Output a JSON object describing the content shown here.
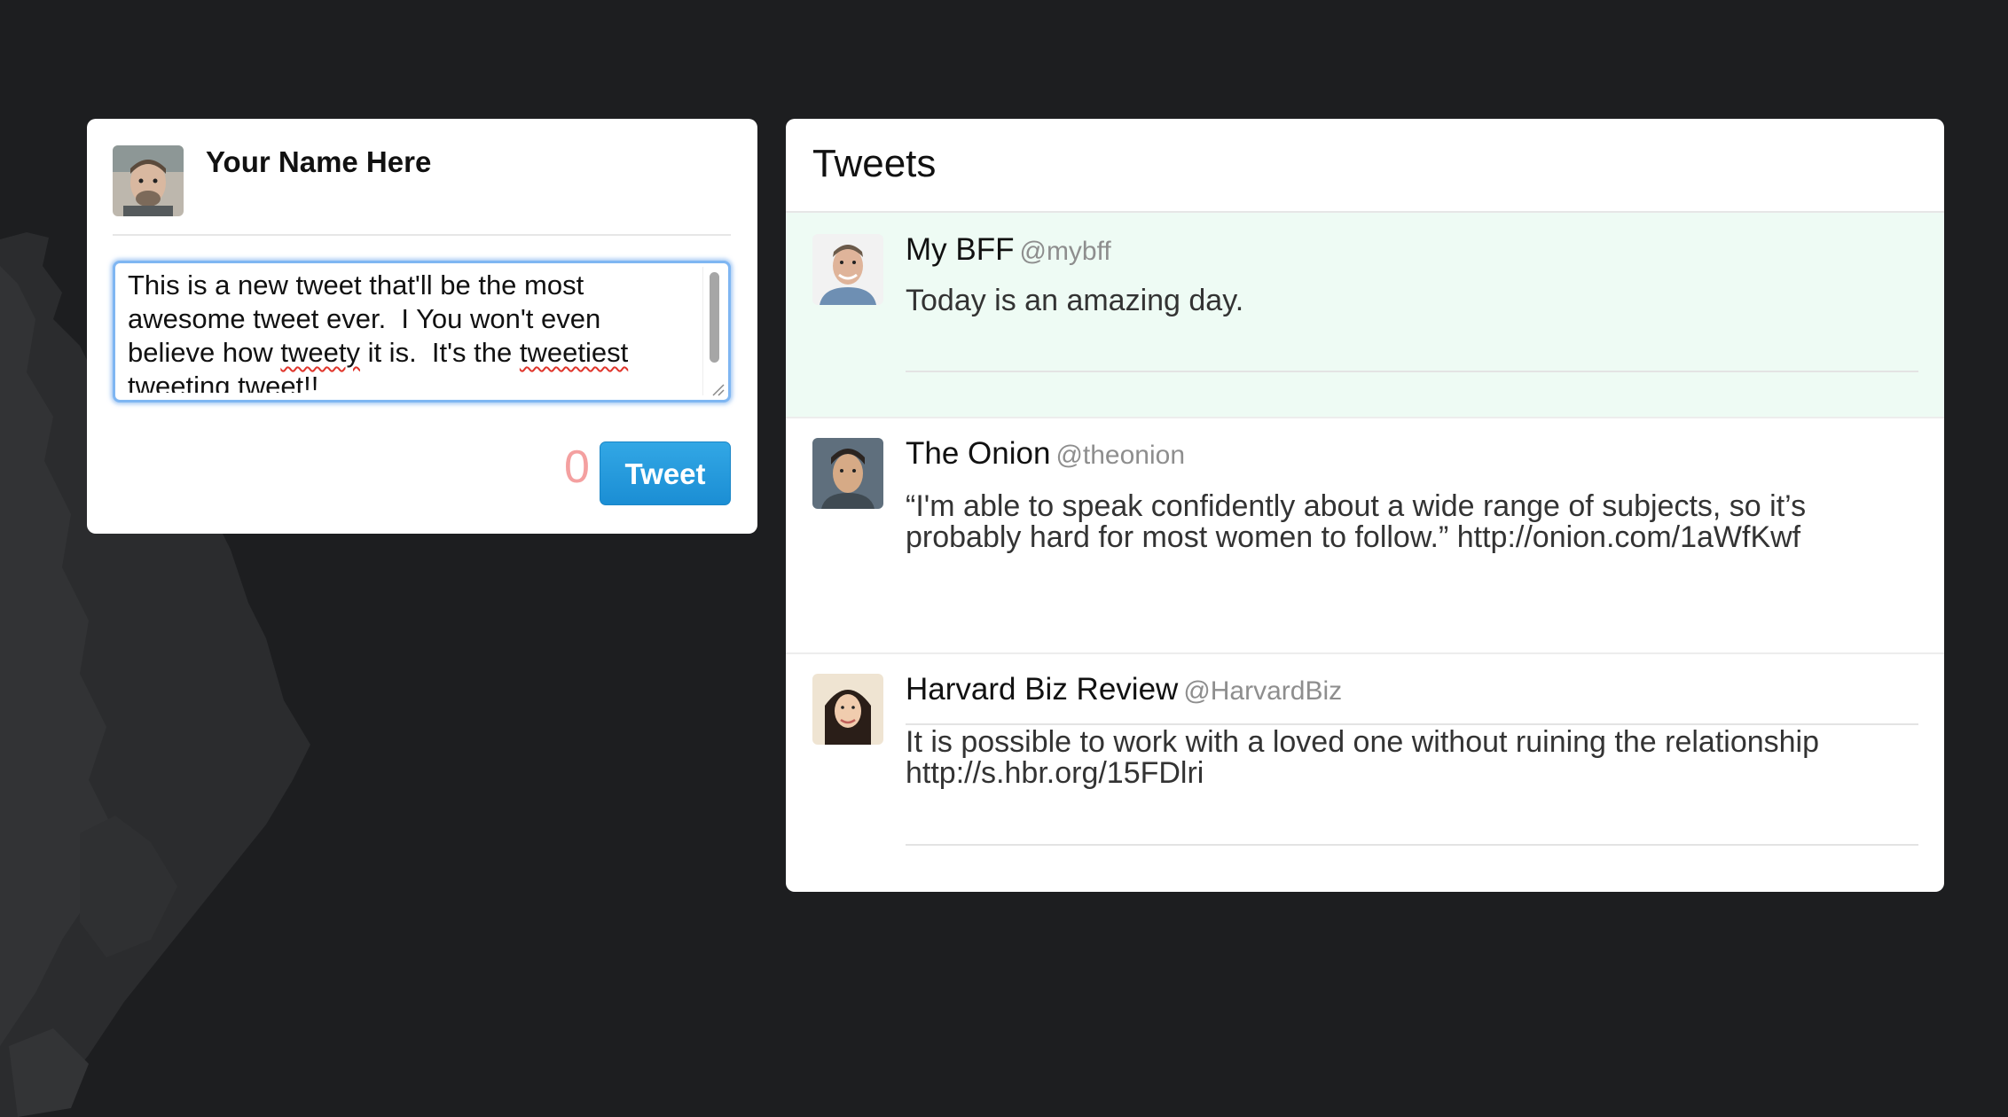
{
  "compose": {
    "user_name": "Your Name Here",
    "avatar_icon": "user-avatar-icon",
    "textarea_line1": "This is a new tweet that'll be the most",
    "textarea_line2": "awesome tweet ever.  I You won't even",
    "textarea_line3_a": "believe how ",
    "textarea_line3_b": "tweety",
    "textarea_line3_c": " it is.  It's the ",
    "textarea_line3_d": "tweetiest",
    "textarea_line4": "tweeting tweet!!",
    "char_count": "0",
    "tweet_button_label": "Tweet"
  },
  "feed": {
    "title": "Tweets",
    "tweets": [
      {
        "author": "My BFF",
        "handle": "@mybff",
        "text_line1": "Today is an amazing day.",
        "text_line2": "",
        "highlighted": true
      },
      {
        "author": "The Onion",
        "handle": "@theonion",
        "text_line1": "“I'm able to speak confidently about a wide range of subjects, so it’s",
        "text_line2": "probably hard for most women to follow.” http://onion.com/1aWfKwf",
        "highlighted": false
      },
      {
        "author": "Harvard Biz Review",
        "handle": "@HarvardBiz",
        "text_line1": "It is possible to work with a loved one without ruining the relationship",
        "text_line2": "http://s.hbr.org/15FDlri",
        "highlighted": false
      }
    ]
  },
  "colors": {
    "background": "#1d1e20",
    "accent_blue": "#1b8ed4",
    "highlight_row": "#eefbf4",
    "char_count": "#f4a0a0"
  }
}
